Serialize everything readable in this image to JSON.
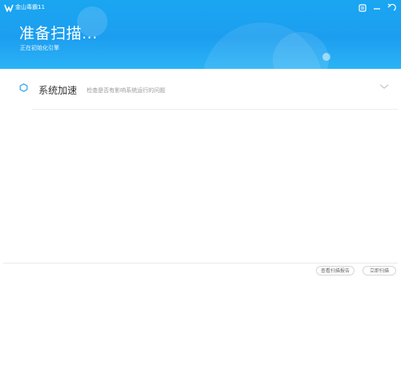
{
  "window": {
    "app_title": "金山毒霸11",
    "controls": {
      "settings_icon": "gear-icon",
      "minimize_icon": "minimize-icon",
      "back_icon": "back-arrow-icon"
    }
  },
  "header": {
    "scan_title": "准备扫描...",
    "scan_subtitle": "正在初始化引擎",
    "colors": {
      "accent": "#1c9ef0",
      "text": "#ffffff"
    }
  },
  "scan_items": [
    {
      "icon": "hexagon-status-icon",
      "label": "系统加速",
      "description": "检查是否有影响系统运行的问题",
      "expand_icon": "chevron-down-icon"
    }
  ],
  "footer": {
    "buttons": [
      {
        "label": "查看扫描报告"
      },
      {
        "label": "立即扫描"
      }
    ]
  }
}
